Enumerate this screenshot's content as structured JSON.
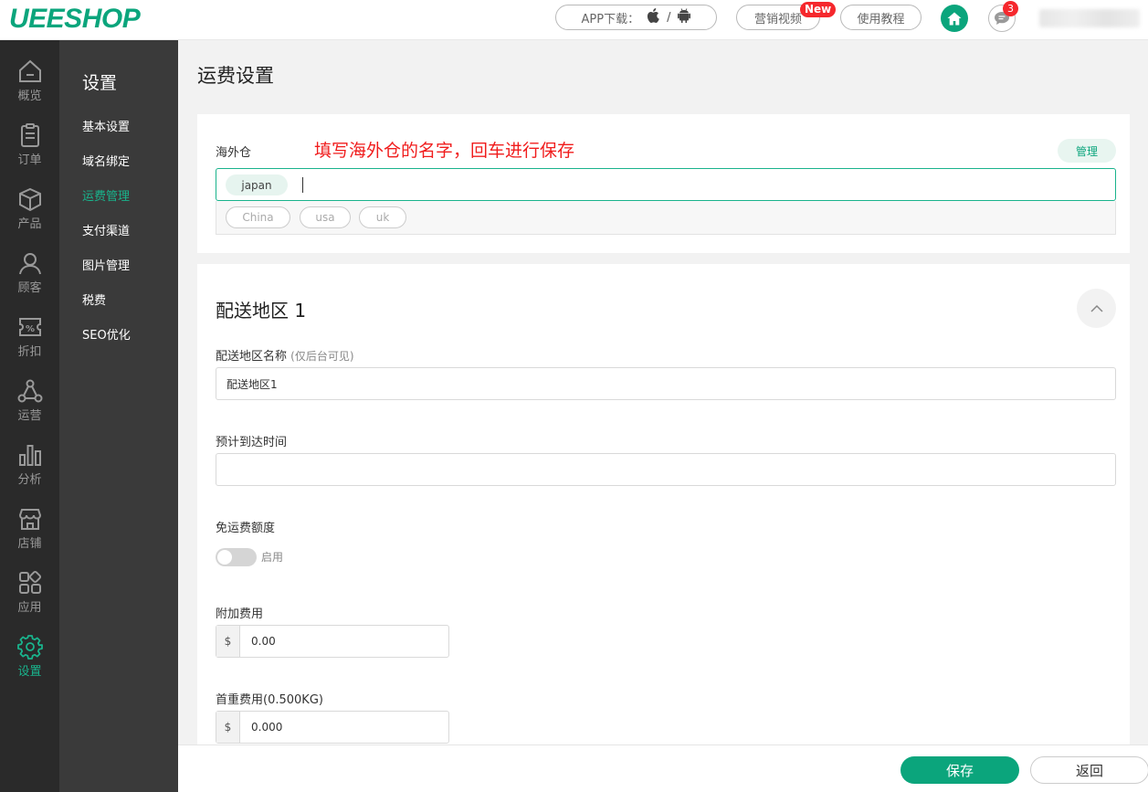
{
  "header": {
    "logo": "UEESHOP",
    "app_download_label": "APP下载：",
    "app_sep": "/",
    "marketing_video": "营销视频",
    "new_badge": "New",
    "tutorial": "使用教程",
    "message_count": "3"
  },
  "left_nav": [
    {
      "label": "概览",
      "icon": "home-outline-icon"
    },
    {
      "label": "订单",
      "icon": "clipboard-icon"
    },
    {
      "label": "产品",
      "icon": "box-icon"
    },
    {
      "label": "顾客",
      "icon": "user-icon"
    },
    {
      "label": "折扣",
      "icon": "discount-ticket-icon"
    },
    {
      "label": "运营",
      "icon": "network-icon"
    },
    {
      "label": "分析",
      "icon": "bar-chart-icon"
    },
    {
      "label": "店铺",
      "icon": "store-icon"
    },
    {
      "label": "应用",
      "icon": "apps-icon"
    },
    {
      "label": "设置",
      "icon": "gear-icon",
      "active": true
    }
  ],
  "sub_nav": {
    "title": "设置",
    "items": [
      "基本设置",
      "域名绑定",
      "运费管理",
      "支付渠道",
      "图片管理",
      "税费",
      "SEO优化"
    ],
    "active_index": 2
  },
  "page": {
    "title": "运费设置",
    "warehouse": {
      "label": "海外仓",
      "hint": "填写海外仓的名字，回车进行保存",
      "manage_button": "管理",
      "selected_tags": [
        "japan"
      ],
      "suggestions": [
        "China",
        "usa",
        "uk"
      ]
    },
    "zone": {
      "title": "配送地区 1",
      "name_label": "配送地区名称",
      "name_sub": "(仅后台可见)",
      "name_value": "配送地区1",
      "eta_label": "预计到达时间",
      "eta_value": "",
      "free_label": "免运费额度",
      "free_toggle_label": "启用",
      "free_enabled": false,
      "extra_label": "附加费用",
      "currency": "$",
      "extra_value": "0.00",
      "first_weight_label": "首重费用(0.500KG)",
      "first_weight_value": "0.000"
    }
  },
  "footer": {
    "save": "保存",
    "back": "返回"
  },
  "colors": {
    "brand": "#0ba57c",
    "hint_red": "#f01c1c",
    "badge_red": "#f5282d"
  }
}
